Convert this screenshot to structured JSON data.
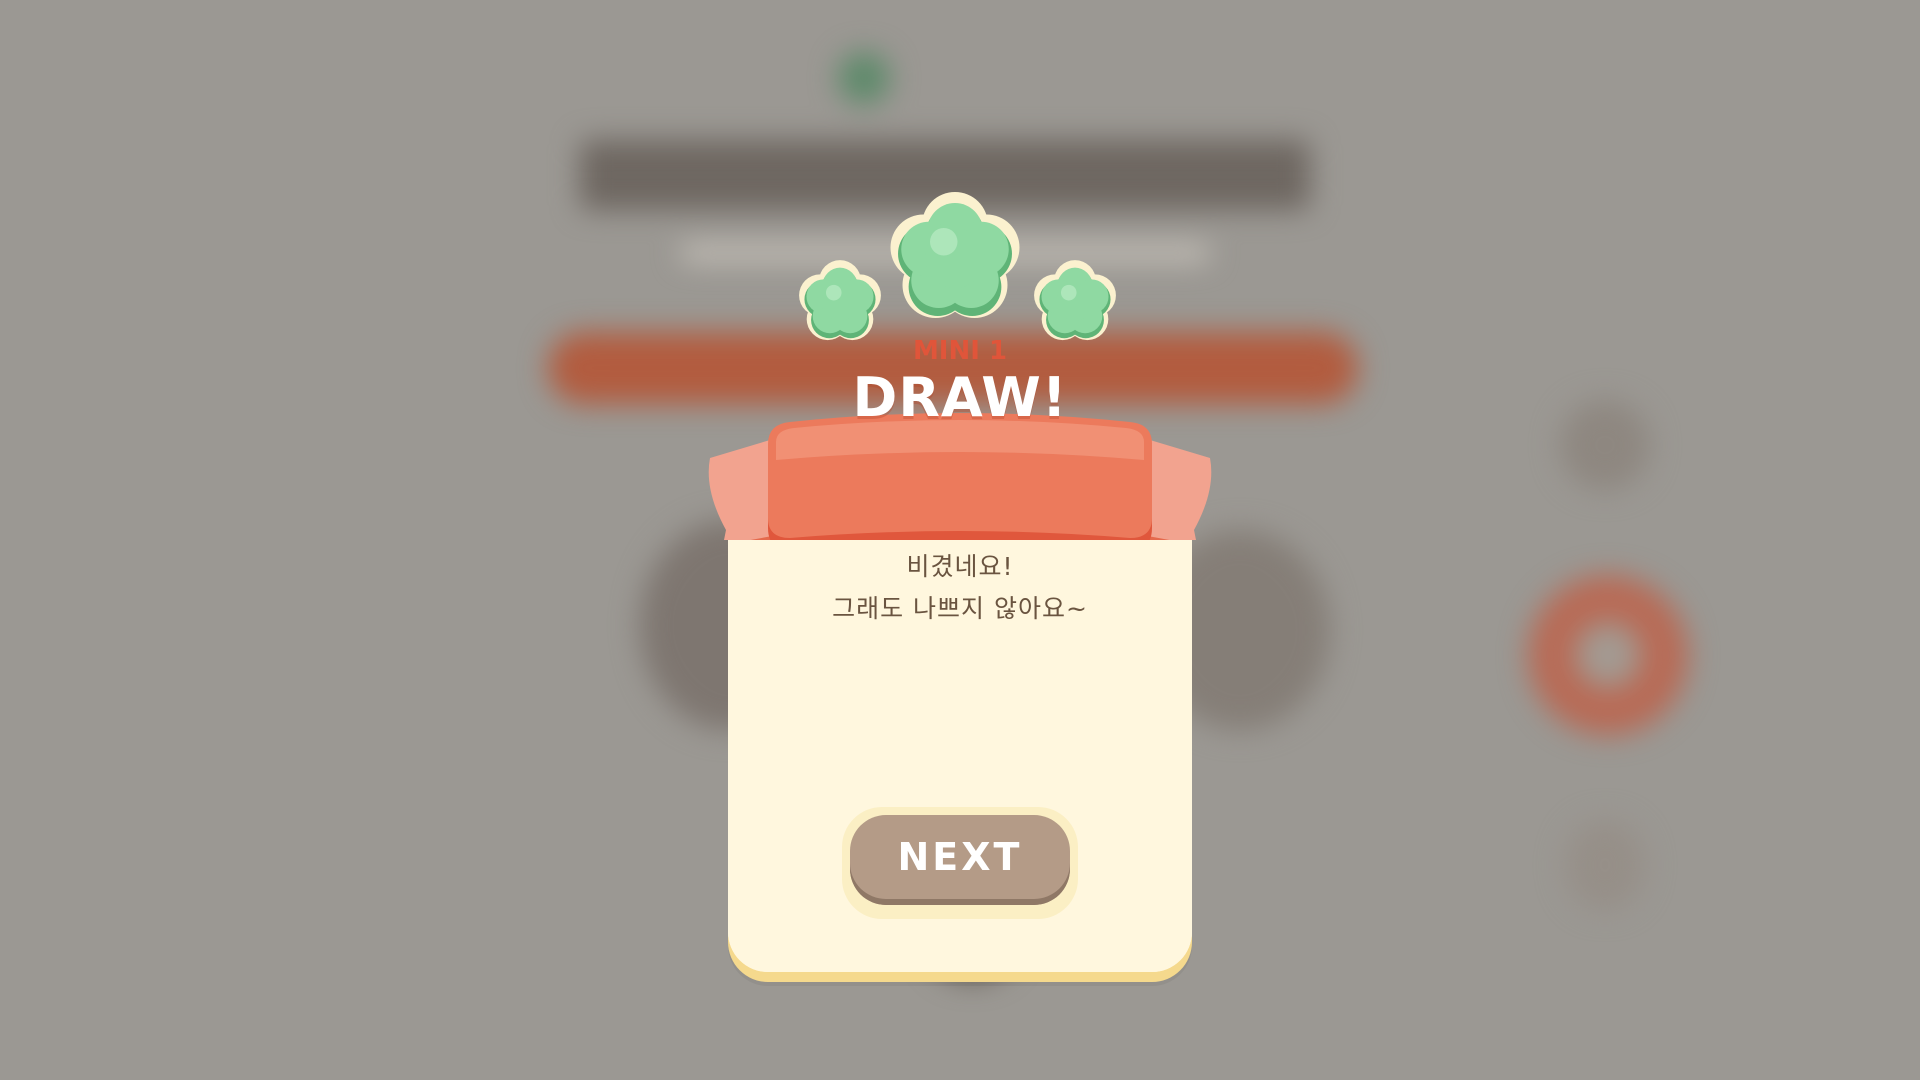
{
  "dialog": {
    "subtitle": "MINI 1",
    "result": "DRAW!",
    "message_line1": "비겼네요!",
    "message_line2": "그래도 나쁘지 않아요~",
    "next_label": "NEXT"
  },
  "colors": {
    "ribbon": "#e96f53",
    "card": "#fff7de",
    "next_button": "#b49b87",
    "clover": "#7fcf93"
  },
  "icons": [
    "clover-icon"
  ]
}
